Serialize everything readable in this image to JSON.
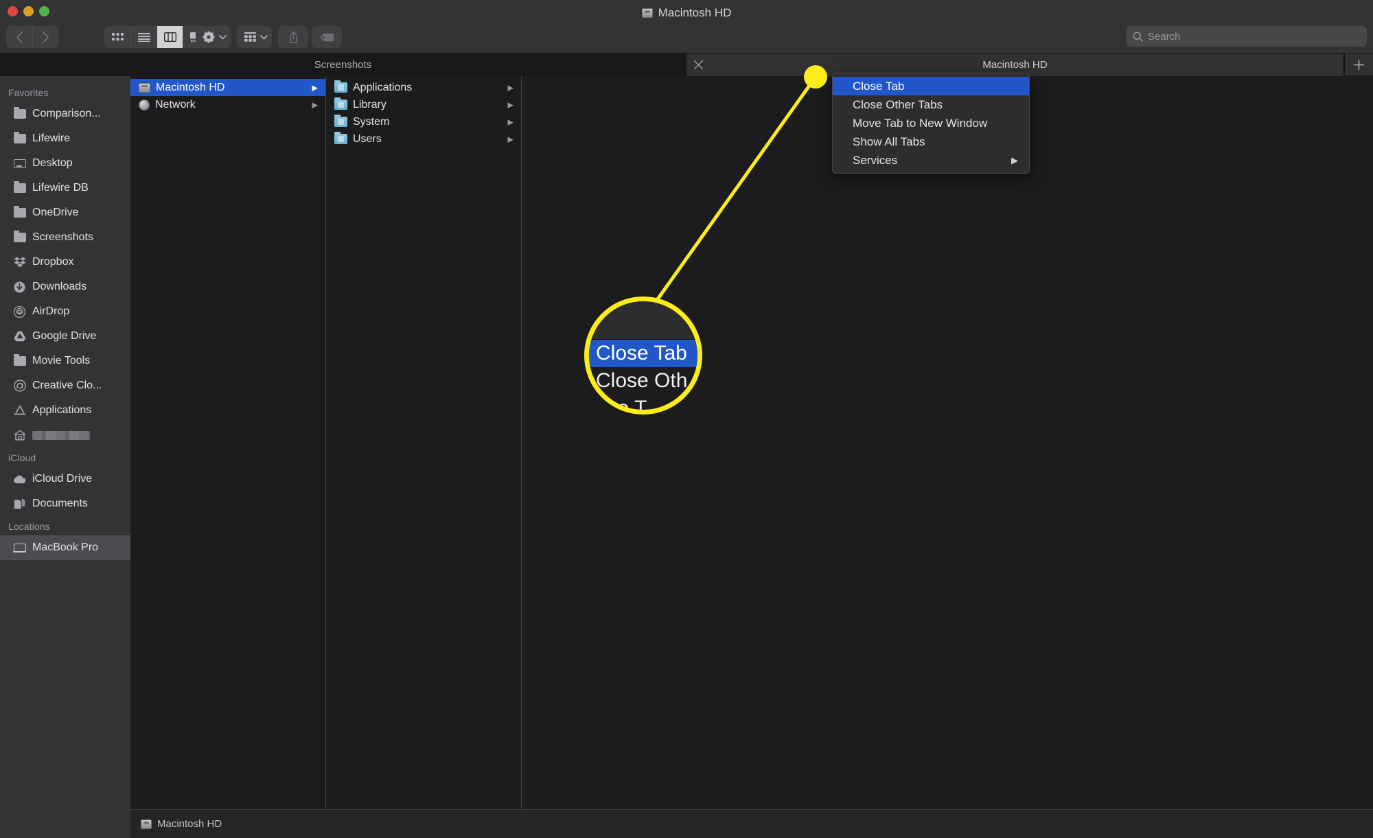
{
  "window": {
    "title": "Macintosh HD",
    "title_icon": "hard-disk-icon",
    "traffic_lights": [
      "close-button",
      "minimize-button",
      "zoom-button"
    ]
  },
  "toolbar": {
    "back_icon": "chevron-left-icon",
    "forward_icon": "chevron-right-icon",
    "view_icon_grid": "icon-view-icon",
    "view_list": "list-view-icon",
    "view_column": "column-view-icon",
    "view_gallery": "gallery-view-icon",
    "action_gear": "gear-icon",
    "action_chevron": "chevron-down-icon",
    "group_icon": "group-by-icon",
    "group_chevron": "chevron-down-icon",
    "share_icon": "share-icon",
    "tag_icon": "tag-icon",
    "active_view": "column"
  },
  "search": {
    "placeholder": "Search",
    "value": "",
    "icon": "search-icon"
  },
  "tabs": {
    "items": [
      {
        "label": "Screenshots",
        "active": false
      },
      {
        "label": "Macintosh HD",
        "active": true
      }
    ],
    "close_icon": "close-x-icon",
    "new_tab_icon": "plus-icon"
  },
  "sidebar": {
    "sections": [
      {
        "title": "Favorites",
        "items": [
          {
            "label": "Comparison...",
            "icon": "folder-icon",
            "selected": false
          },
          {
            "label": "Lifewire",
            "icon": "folder-icon",
            "selected": false
          },
          {
            "label": "Desktop",
            "icon": "desktop-icon",
            "selected": false
          },
          {
            "label": "Lifewire DB",
            "icon": "folder-icon",
            "selected": false
          },
          {
            "label": "OneDrive",
            "icon": "folder-icon",
            "selected": false
          },
          {
            "label": "Screenshots",
            "icon": "folder-icon",
            "selected": false
          },
          {
            "label": "Dropbox",
            "icon": "dropbox-icon",
            "selected": false
          },
          {
            "label": "Downloads",
            "icon": "downloads-icon",
            "selected": false
          },
          {
            "label": "AirDrop",
            "icon": "airdrop-icon",
            "selected": false
          },
          {
            "label": "Google Drive",
            "icon": "google-drive-icon",
            "selected": false
          },
          {
            "label": "Movie Tools",
            "icon": "folder-icon",
            "selected": false
          },
          {
            "label": "Creative Clo...",
            "icon": "creative-cloud-icon",
            "selected": false
          },
          {
            "label": "Applications",
            "icon": "app-store-icon",
            "selected": false
          },
          {
            "label": "",
            "icon": "home-icon",
            "selected": false,
            "redacted": true
          }
        ]
      },
      {
        "title": "iCloud",
        "items": [
          {
            "label": "iCloud Drive",
            "icon": "cloud-icon",
            "selected": false
          },
          {
            "label": "Documents",
            "icon": "documents-icon",
            "selected": false
          }
        ]
      },
      {
        "title": "Locations",
        "items": [
          {
            "label": "MacBook Pro",
            "icon": "laptop-icon",
            "selected": true
          }
        ]
      }
    ]
  },
  "columns": [
    {
      "rows": [
        {
          "label": "Macintosh HD",
          "icon": "hard-disk-icon",
          "selected": true,
          "has_arrow": true
        },
        {
          "label": "Network",
          "icon": "network-globe-icon",
          "selected": false,
          "has_arrow": true
        }
      ]
    },
    {
      "rows": [
        {
          "label": "Applications",
          "icon": "blue-folder-icon",
          "selected": false,
          "has_arrow": true
        },
        {
          "label": "Library",
          "icon": "blue-folder-icon",
          "selected": false,
          "has_arrow": true
        },
        {
          "label": "System",
          "icon": "blue-folder-icon",
          "selected": false,
          "has_arrow": false
        },
        {
          "label": "Users",
          "icon": "blue-folder-icon",
          "selected": false,
          "has_arrow": false
        }
      ]
    },
    {
      "rows": []
    }
  ],
  "context_menu": {
    "items": [
      {
        "label": "Close Tab",
        "highlighted": true,
        "submenu": false
      },
      {
        "label": "Close Other Tabs",
        "highlighted": false,
        "submenu": false
      },
      {
        "label": "Move Tab to New Window",
        "highlighted": false,
        "submenu": false
      },
      {
        "label": "Show All Tabs",
        "highlighted": false,
        "submenu": false
      },
      {
        "label": "Services",
        "highlighted": false,
        "submenu": true,
        "submenu_icon": "chevron-right-icon"
      }
    ]
  },
  "callout": {
    "color": "#fcec18",
    "magnified_rows": [
      "Close Tab",
      "Close Oth",
      "ove T"
    ]
  },
  "statusbar": {
    "label": "Macintosh HD",
    "icon": "hard-disk-icon"
  }
}
